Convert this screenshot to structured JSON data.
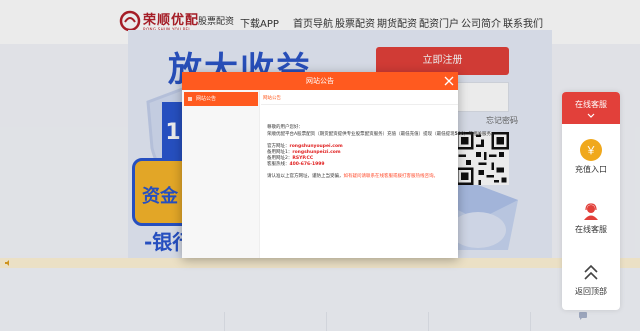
{
  "header": {
    "logo_name": "荣顺优配",
    "logo_sub": "RONG SHUN YOU PEI",
    "logo_tag": "股票配资",
    "nav": [
      "下载APP",
      "首页导航",
      "股票配资",
      "期货配资",
      "配资门户",
      "公司简介",
      "联系我们"
    ]
  },
  "banner": {
    "big_text": "放大收益",
    "blue_digit": "1",
    "gold_text": "资金",
    "bank_text": "-银行"
  },
  "panel": {
    "button_label": "立即注册",
    "link_text": "忘记密码"
  },
  "float": {
    "top_label": "在线客服",
    "coin_label": "充值入口",
    "service_label": "在线客服",
    "top_back_label": "返回顶部"
  },
  "modal": {
    "title": "网站公告",
    "side_item": "网站公告",
    "crumb": "网站公告",
    "greeting": "尊敬的用户您好：",
    "line1_pre": "荣顺优配平台A股票配资（期货配资提供专业股票配资服务）充值（最低充值）提现（最低提现",
    "line1_amount": "500",
    "line1_post": "）等相关服务。",
    "url_label": "官方网址：",
    "url_value": "rongshunyoupei.com",
    "backup_label": "备用网址1：",
    "backup_value": "rongshunpeizi.com",
    "backup2_label": "备用网址2：",
    "backup2_value": "RSYP.CC",
    "phone_label": "客服热线：",
    "phone_value": "400-676-1999",
    "notice_pre": "请认准以上官方网址，谨防上当受骗，",
    "notice_red": "如有疑问请联系在线客服或拨打客服热线咨询。"
  },
  "colors": {
    "accent": "#ff5a1f",
    "brand_red": "#e2403a",
    "banner_blue": "#2a56d0",
    "gold": "#f6b52b"
  }
}
